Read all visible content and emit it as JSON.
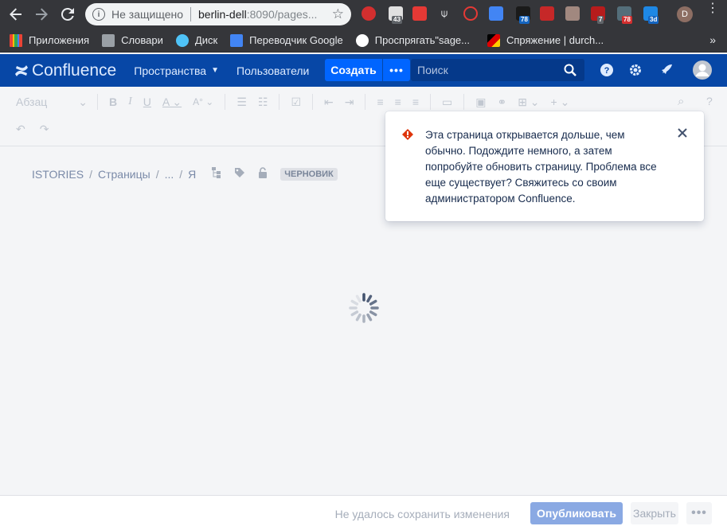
{
  "browser": {
    "security_label": "Не защищено",
    "url_host": "berlin-dell",
    "url_rest": ":8090/pages...",
    "profile_initial": "D",
    "ext_badges": [
      "43",
      "78",
      "7",
      "78",
      "3d"
    ]
  },
  "bookmarks": {
    "items": [
      "Приложения",
      "Словари",
      "Диск",
      "Переводчик Google",
      "Проспрягать\"sage...",
      "Спряжение | durch..."
    ],
    "more": "»"
  },
  "confluence": {
    "logo": "Confluence",
    "nav": {
      "spaces": "Пространства",
      "people": "Пользователи"
    },
    "create": "Создать",
    "more": "•••",
    "search_placeholder": "Поиск"
  },
  "toolbar": {
    "paragraph_style": "Абзац"
  },
  "breadcrumb": {
    "space": "ISTORIES",
    "pages": "Страницы",
    "ellipsis": "...",
    "current": "Я",
    "draft": "ЧЕРНОВИК"
  },
  "notification": {
    "message": "Эта страница открывается дольше, чем обычно. Подождите немного, а затем попробуйте обновить страницу. Проблема все еще существует? Свяжитесь со своим администратором Confluence."
  },
  "footer": {
    "status": "Не удалось сохранить изменения",
    "publish": "Опубликовать",
    "close": "Закрыть",
    "more": "•••"
  },
  "colors": {
    "header_bg": "#0747a6",
    "create_bg": "#0065ff",
    "publish_bg": "#8aa9e3",
    "warning": "#de350b"
  }
}
